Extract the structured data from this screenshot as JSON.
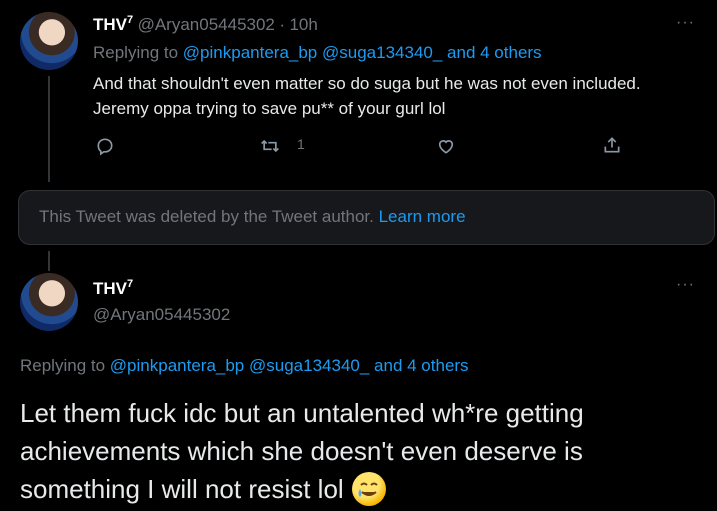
{
  "reply1": {
    "display_name": "THV",
    "superscript": "7",
    "handle": "@Aryan05445302",
    "dot": "·",
    "time": "10h",
    "replying_to": {
      "prefix": "Replying to",
      "mention1": "@pinkpantera_bp",
      "mention2": "@suga134340_",
      "others": "and 4 others"
    },
    "text_line1": "And that shouldn't even matter so do suga but he was not even included.",
    "text_line2": "Jeremy oppa trying to save pu** of your gurl lol",
    "retweet_count": "1",
    "more_dots": "···"
  },
  "deleted_tweet": {
    "message": "This Tweet was deleted by the Tweet author.",
    "link": "Learn more"
  },
  "main_tweet": {
    "display_name": "THV",
    "superscript": "7",
    "handle": "@Aryan05445302",
    "more_dots": "···",
    "replying_to": {
      "prefix": "Replying to",
      "mention1": "@pinkpantera_bp",
      "mention2": "@suga134340_",
      "others": "and 4 others"
    },
    "text_line1": "Let them fuck idc but an untalented wh*re getting",
    "text_line2": "achievements which she doesn't even deserve is",
    "text_line3": "something I will not resist lol",
    "emoji": "sweat-smile-tear-emoji"
  },
  "colors": {
    "background": "#000000",
    "accent_blue": "#1d9bf0",
    "muted": "#71767b",
    "text": "#d9d9d9"
  }
}
